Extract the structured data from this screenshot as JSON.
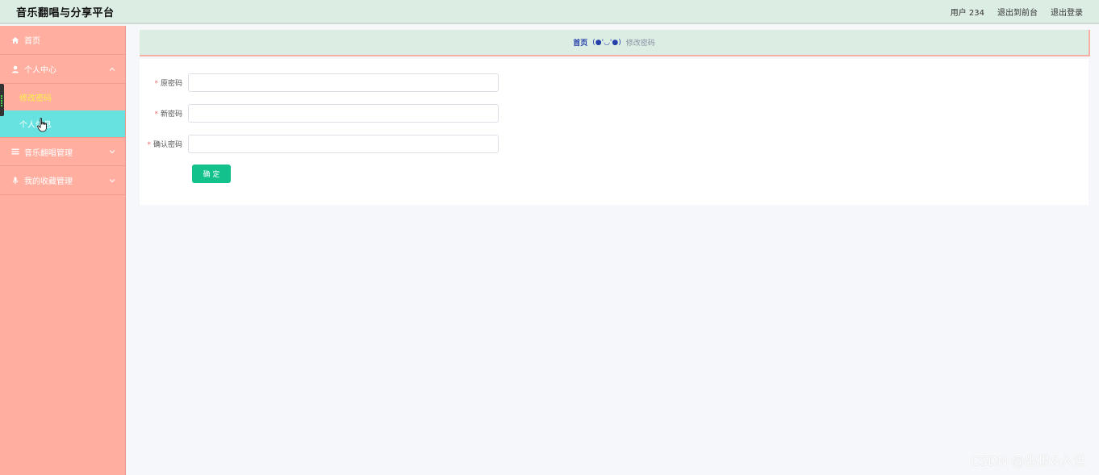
{
  "header": {
    "title": "音乐翻唱与分享平台",
    "user": "用户 234",
    "back_to_front": "退出到前台",
    "logout": "退出登录"
  },
  "sidebar": {
    "items": [
      {
        "label": "首页",
        "icon": "home-icon"
      },
      {
        "label": "个人中心",
        "icon": "user-icon",
        "expanded": true,
        "children": [
          {
            "label": "修改密码",
            "state": "active"
          },
          {
            "label": "个人信息",
            "state": "hover"
          }
        ]
      },
      {
        "label": "音乐翻唱管理",
        "icon": "list-icon",
        "expanded": false
      },
      {
        "label": "我的收藏管理",
        "icon": "microphone-icon",
        "expanded": false
      }
    ]
  },
  "breadcrumb": {
    "home": "首页",
    "separator": "(●'◡'●)",
    "current": "修改密码"
  },
  "form": {
    "fields": [
      {
        "label": "原密码",
        "value": "",
        "required": true
      },
      {
        "label": "新密码",
        "value": "",
        "required": true
      },
      {
        "label": "确认密码",
        "value": "",
        "required": true
      }
    ],
    "submit_label": "确 定"
  },
  "colors": {
    "sidebar_bg": "#ffaea0",
    "header_bg": "#dcede4",
    "active_text": "#fdf24a",
    "hover_bg": "#67e2e0",
    "primary_button": "#13c18d"
  },
  "watermark": "CSDN @出世&入世"
}
